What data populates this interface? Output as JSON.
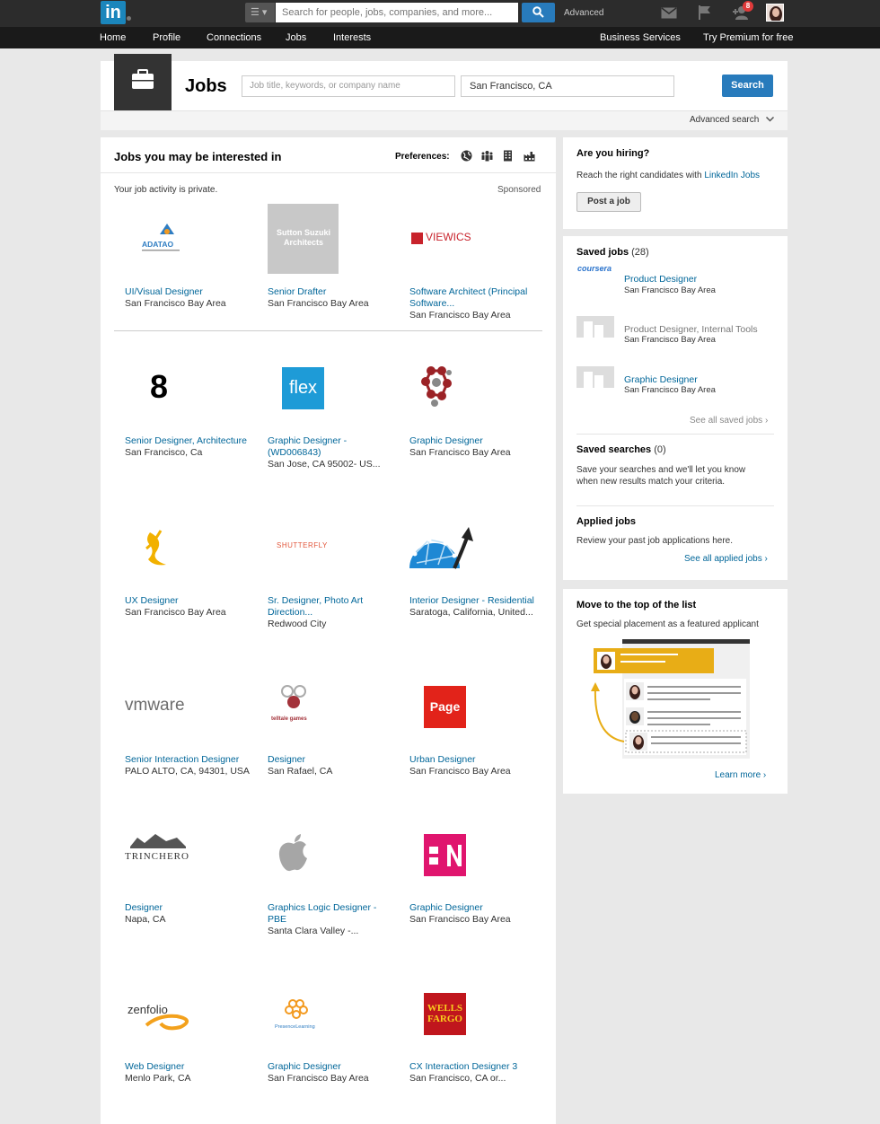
{
  "topbar": {
    "logo_text": "in",
    "search_placeholder": "Search for people, jobs, companies, and more...",
    "advanced_label": "Advanced",
    "notification_count": "8"
  },
  "nav": {
    "items": [
      "Home",
      "Profile",
      "Connections",
      "Jobs",
      "Interests"
    ],
    "business": "Business Services",
    "premium": "Try Premium for free"
  },
  "jobs_search": {
    "title": "Jobs",
    "keyword_placeholder": "Job title, keywords, or company name",
    "location_value": "San Francisco, CA",
    "search_label": "Search",
    "advanced_search": "Advanced search"
  },
  "main": {
    "heading": "Jobs you may be interested in",
    "preferences_label": "Preferences:",
    "private_text": "Your job activity is private.",
    "sponsored": "Sponsored",
    "jobs": [
      {
        "company_logo": "ADATAO",
        "title1": "UI/Visual Designer",
        "title2": "",
        "location": "San Francisco Bay Area"
      },
      {
        "company_logo": "Sutton Suzuki Architects",
        "title1": "Senior Drafter",
        "title2": "",
        "location": "San Francisco Bay Area"
      },
      {
        "company_logo": "VIEWICS",
        "title1": "Software Architect (Principal",
        "title2": "Software...",
        "location": "San Francisco Bay Area"
      },
      {
        "company_logo": "8",
        "title1": "Senior Designer, Architecture",
        "title2": "",
        "location": "San Francisco, Ca"
      },
      {
        "company_logo": "flex",
        "title1": "Graphic Designer -",
        "title2": "(WD006843)",
        "location": "San Jose, CA 95002- US..."
      },
      {
        "company_logo": "",
        "title1": "Graphic Designer",
        "title2": "",
        "location": "San Francisco Bay Area"
      },
      {
        "company_logo": "",
        "title1": "UX Designer",
        "title2": "",
        "location": "San Francisco Bay Area"
      },
      {
        "company_logo": "SHUTTERFLY",
        "title1": "Sr. Designer, Photo Art",
        "title2": "Direction...",
        "location": "Redwood City"
      },
      {
        "company_logo": "",
        "title1": "Interior Designer - Residential",
        "title2": "",
        "location": "Saratoga, California, United..."
      },
      {
        "company_logo": "vmware",
        "title1": "Senior Interaction Designer",
        "title2": "",
        "location": "PALO ALTO, CA, 94301, USA"
      },
      {
        "company_logo": "telltale games",
        "title1": "Designer",
        "title2": "",
        "location": "San Rafael, CA"
      },
      {
        "company_logo": "Page",
        "title1": "Urban Designer",
        "title2": "",
        "location": "San Francisco Bay Area"
      },
      {
        "company_logo": "TRINCHERO",
        "title1": "Designer",
        "title2": "",
        "location": "Napa, CA"
      },
      {
        "company_logo": "",
        "title1": "Graphics Logic Designer -",
        "title2": "PBE",
        "location": "Santa Clara Valley -..."
      },
      {
        "company_logo": "",
        "title1": "Graphic Designer",
        "title2": "",
        "location": "San Francisco Bay Area"
      },
      {
        "company_logo": "zenfolio",
        "title1": "Web Designer",
        "title2": "",
        "location": "Menlo Park, CA"
      },
      {
        "company_logo": "PresenceLearning",
        "title1": "Graphic Designer",
        "title2": "",
        "location": "San Francisco Bay Area"
      },
      {
        "company_logo": "WELLS FARGO",
        "title1": "CX Interaction Designer 3",
        "title2": "",
        "location": "San Francisco, CA or..."
      }
    ]
  },
  "hiring": {
    "heading": "Are you hiring?",
    "text": "Reach the right candidates with",
    "link": "LinkedIn Jobs",
    "button": "Post a job"
  },
  "saved": {
    "heading": "Saved jobs",
    "count": "(28)",
    "items": [
      {
        "logo": "coursera",
        "title": "Product Designer",
        "location": "San Francisco Bay Area"
      },
      {
        "logo": "",
        "title": "Product Designer, Internal Tools",
        "location": "San Francisco Bay Area"
      },
      {
        "logo": "",
        "title": "Graphic Designer",
        "location": "San Francisco Bay Area"
      }
    ],
    "see_all": "See all saved jobs",
    "searches_heading": "Saved searches",
    "searches_count": "(0)",
    "searches_text1": "Save your searches and we'll let you know",
    "searches_text2": "when new results match your criteria.",
    "applied_heading": "Applied jobs",
    "applied_text": "Review your past job applications here.",
    "applied_link": "See all applied jobs"
  },
  "featured": {
    "heading": "Move to the top of the list",
    "text": "Get special placement as a featured applicant",
    "learn_more": "Learn more"
  },
  "colors": {
    "linkedin_blue": "#1b86bc",
    "link": "#006699",
    "accent_gold": "#e0a800"
  }
}
